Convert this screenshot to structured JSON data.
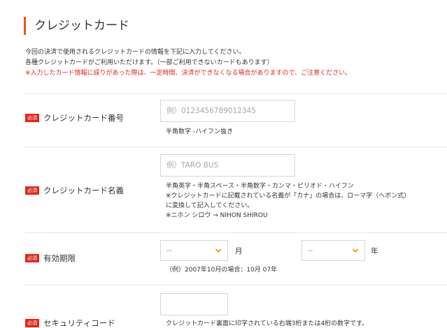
{
  "page": {
    "title": "クレジットカード"
  },
  "intro": {
    "line1": "今回の決済で使用されるクレジットカードの情報を下記に入力してください。",
    "line2": "各種クレジットカードがご利用いただけます。（一部ご利用できないカードもあります）",
    "warning": "※入力したカード情報に誤りがあった際は、一定時間、決済ができなくなる場合がありますので、ご注意ください。"
  },
  "required_badge": "必須",
  "card_number": {
    "label": "クレジットカード番号",
    "placeholder": "例）0123456789012345",
    "note": "半角数字 -ハイフン抜き"
  },
  "card_name": {
    "label": "クレジットカード名義",
    "placeholder": "例）TARO BUS",
    "notes": [
      "半角英字・半角スペース・半角数字・カンマ・ピリオド・ハイフン",
      "※クレジットカードに記載されている名義が「カナ」の場合は、ローマ字（ヘボン式）",
      "に変換して記入してください。",
      "※ニホン シロウ → NIHON SHIROU"
    ]
  },
  "expiry": {
    "label": "有効期限",
    "month_value": "--",
    "month_unit": "月",
    "year_value": "--",
    "year_unit": "年",
    "note": "（例）2007年10月の場合：10月 07年"
  },
  "security_code": {
    "label": "セキュリティコード",
    "note": "クレジットカード裏面に印字されている右端3桁または4桁の数字です。"
  },
  "colors": {
    "accent": "#e8561a",
    "required": "#e0261b",
    "chevron": "#e89b1a"
  }
}
